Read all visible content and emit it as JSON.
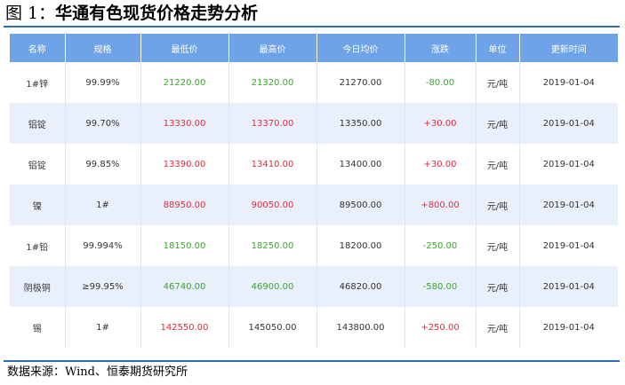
{
  "figure": {
    "label": "图 1：",
    "title": "华通有色现货价格走势分析"
  },
  "colors": {
    "rule": "#2e6bb0",
    "header_bg": "#6fa3e8",
    "row_alt_bg": "#e9f0fb",
    "up": "#e8283c",
    "down": "#3aa52c",
    "neutral": "#333333"
  },
  "table": {
    "headers": [
      "名称",
      "规格",
      "最低价",
      "最高价",
      "今日均价",
      "涨跌",
      "单位",
      "更新时间"
    ],
    "rows": [
      {
        "name": "1#锌",
        "spec": "99.99%",
        "low": "21220.00",
        "high": "21320.00",
        "avg": "21270.00",
        "change": "-80.00",
        "unit": "元/吨",
        "date": "2019-01-04",
        "low_color": "down",
        "high_color": "down",
        "change_color": "down"
      },
      {
        "name": "铝锭",
        "spec": "99.70%",
        "low": "13330.00",
        "high": "13370.00",
        "avg": "13350.00",
        "change": "+30.00",
        "unit": "元/吨",
        "date": "2019-01-04",
        "low_color": "up",
        "high_color": "up",
        "change_color": "up"
      },
      {
        "name": "铝锭",
        "spec": "99.85%",
        "low": "13390.00",
        "high": "13410.00",
        "avg": "13400.00",
        "change": "+30.00",
        "unit": "元/吨",
        "date": "2019-01-04",
        "low_color": "up",
        "high_color": "up",
        "change_color": "up"
      },
      {
        "name": "镍",
        "spec": "1#",
        "low": "88950.00",
        "high": "90050.00",
        "avg": "89500.00",
        "change": "+800.00",
        "unit": "元/吨",
        "date": "2019-01-04",
        "low_color": "up",
        "high_color": "up",
        "change_color": "up"
      },
      {
        "name": "1#铅",
        "spec": "99.994%",
        "low": "18150.00",
        "high": "18250.00",
        "avg": "18200.00",
        "change": "-250.00",
        "unit": "元/吨",
        "date": "2019-01-04",
        "low_color": "down",
        "high_color": "down",
        "change_color": "down"
      },
      {
        "name": "阴极铜",
        "spec": "≥99.95%",
        "low": "46740.00",
        "high": "46900.00",
        "avg": "46820.00",
        "change": "-580.00",
        "unit": "元/吨",
        "date": "2019-01-04",
        "low_color": "down",
        "high_color": "down",
        "change_color": "down"
      },
      {
        "name": "锡",
        "spec": "1#",
        "low": "142550.00",
        "high": "145050.00",
        "avg": "143800.00",
        "change": "+250.00",
        "unit": "元/吨",
        "date": "2019-01-04",
        "low_color": "up",
        "high_color": "neutral",
        "change_color": "up"
      }
    ]
  },
  "source": "数据来源：Wind、恒泰期货研究所"
}
